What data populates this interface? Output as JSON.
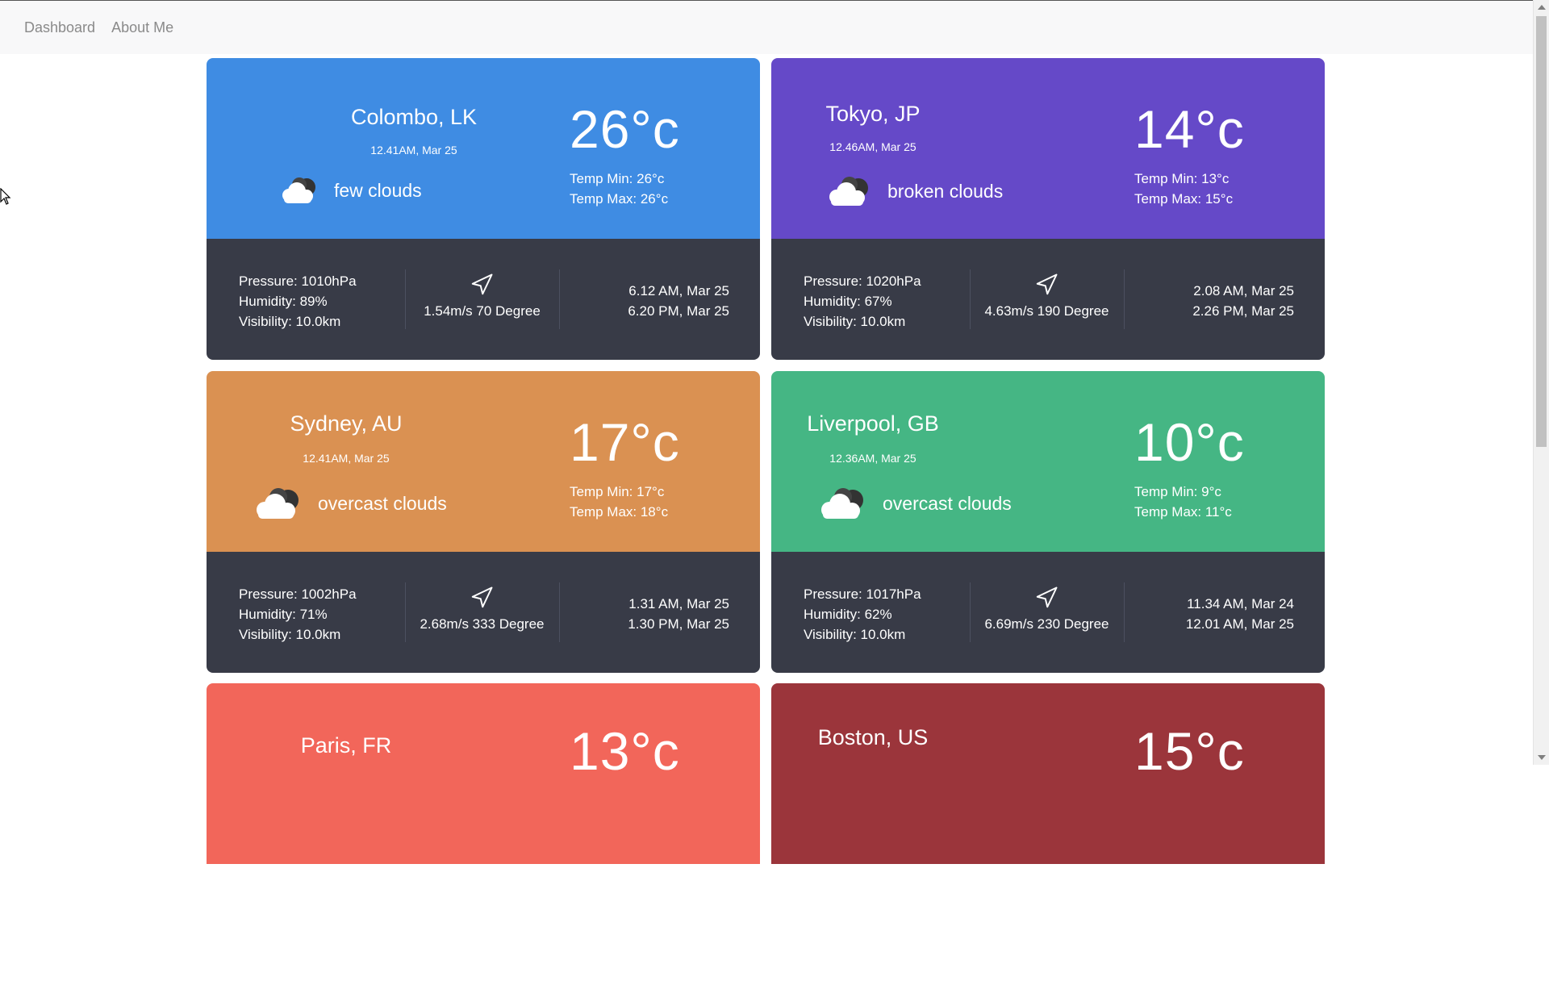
{
  "nav": {
    "items": [
      {
        "label": "Dashboard"
      },
      {
        "label": "About Me"
      }
    ]
  },
  "cards": [
    {
      "city": "Colombo, LK",
      "time": "12.41AM, Mar 25",
      "condition": "few clouds",
      "temp": "26°c",
      "temp_min": "Temp Min: 26°c",
      "temp_max": "Temp Max: 26°c",
      "pressure": "Pressure: 1010hPa",
      "humidity": "Humidity: 89%",
      "visibility": "Visibility: 10.0km",
      "wind": "1.54m/s 70 Degree",
      "sunrise": "6.12 AM, Mar 25",
      "sunset": "6.20 PM, Mar 25",
      "color": "#3f8ce3"
    },
    {
      "city": "Tokyo, JP",
      "time": "12.46AM, Mar 25",
      "condition": "broken clouds",
      "temp": "14°c",
      "temp_min": "Temp Min: 13°c",
      "temp_max": "Temp Max: 15°c",
      "pressure": "Pressure: 1020hPa",
      "humidity": "Humidity: 67%",
      "visibility": "Visibility: 10.0km",
      "wind": "4.63m/s 190 Degree",
      "sunrise": "2.08 AM, Mar 25",
      "sunset": "2.26 PM, Mar 25",
      "color": "#6549c8"
    },
    {
      "city": "Sydney, AU",
      "time": "12.41AM, Mar 25",
      "condition": "overcast clouds",
      "temp": "17°c",
      "temp_min": "Temp Min: 17°c",
      "temp_max": "Temp Max: 18°c",
      "pressure": "Pressure: 1002hPa",
      "humidity": "Humidity: 71%",
      "visibility": "Visibility: 10.0km",
      "wind": "2.68m/s 333 Degree",
      "sunrise": "1.31 AM, Mar 25",
      "sunset": "1.30 PM, Mar 25",
      "color": "#da9152"
    },
    {
      "city": "Liverpool, GB",
      "time": "12.36AM, Mar 25",
      "condition": "overcast clouds",
      "temp": "10°c",
      "temp_min": "Temp Min: 9°c",
      "temp_max": "Temp Max: 11°c",
      "pressure": "Pressure: 1017hPa",
      "humidity": "Humidity: 62%",
      "visibility": "Visibility: 10.0km",
      "wind": "6.69m/s 230 Degree",
      "sunrise": "11.34 AM, Mar 24",
      "sunset": "12.01 AM, Mar 25",
      "color": "#45b684"
    },
    {
      "city": "Paris, FR",
      "temp": "13°c",
      "color": "#f2665a"
    },
    {
      "city": "Boston, US",
      "temp": "15°c",
      "color": "#9b353b"
    }
  ]
}
